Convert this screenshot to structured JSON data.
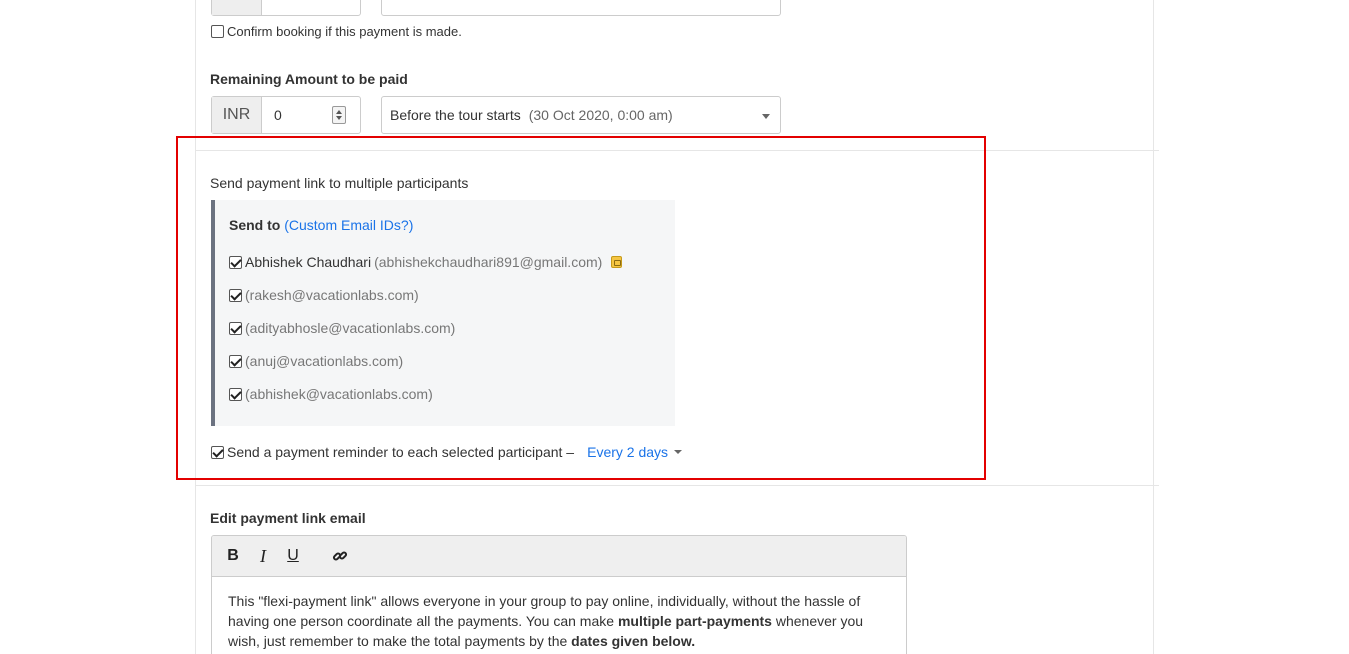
{
  "top": {
    "confirm_label": "Confirm booking if this payment is made.",
    "confirm_checked": false
  },
  "remaining": {
    "label": "Remaining Amount to be paid",
    "currency": "INR",
    "amount": "0",
    "due_option": "Before the tour starts",
    "due_date": "(30 Oct 2020, 0:00 am)"
  },
  "multi": {
    "section_label": "Send payment link to multiple participants",
    "send_to_label": "Send to",
    "custom_link": "(Custom Email IDs?)",
    "participants": [
      {
        "name": "Abhishek Chaudhari",
        "email": "(abhishekchaudhari891@gmail.com)",
        "checked": true,
        "icon": "contact-card-icon"
      },
      {
        "name": "",
        "email": "(rakesh@vacationlabs.com)",
        "checked": true
      },
      {
        "name": "",
        "email": "(adityabhosle@vacationlabs.com)",
        "checked": true
      },
      {
        "name": "",
        "email": "(anuj@vacationlabs.com)",
        "checked": true
      },
      {
        "name": "",
        "email": "(abhishek@vacationlabs.com)",
        "checked": true
      }
    ],
    "reminder_label": "Send a payment reminder to each selected participant –",
    "reminder_checked": true,
    "reminder_frequency": "Every 2 days"
  },
  "email": {
    "label": "Edit payment link email",
    "toolbar": {
      "bold": "B",
      "italic": "I",
      "underline": "U",
      "link_icon": "link-icon"
    },
    "body_part1": "This \"flexi-payment link\" allows everyone in your group to pay online, individually, without the hassle of having one person coordinate all the payments. You can make ",
    "body_bold1": "multiple part-payments",
    "body_part2": " whenever you wish, just remember to make the total payments by the ",
    "body_bold2": "dates given below."
  },
  "colors": {
    "highlight_border": "#e30000",
    "link": "#1a73e8",
    "panel_bg": "#f5f6f7"
  }
}
